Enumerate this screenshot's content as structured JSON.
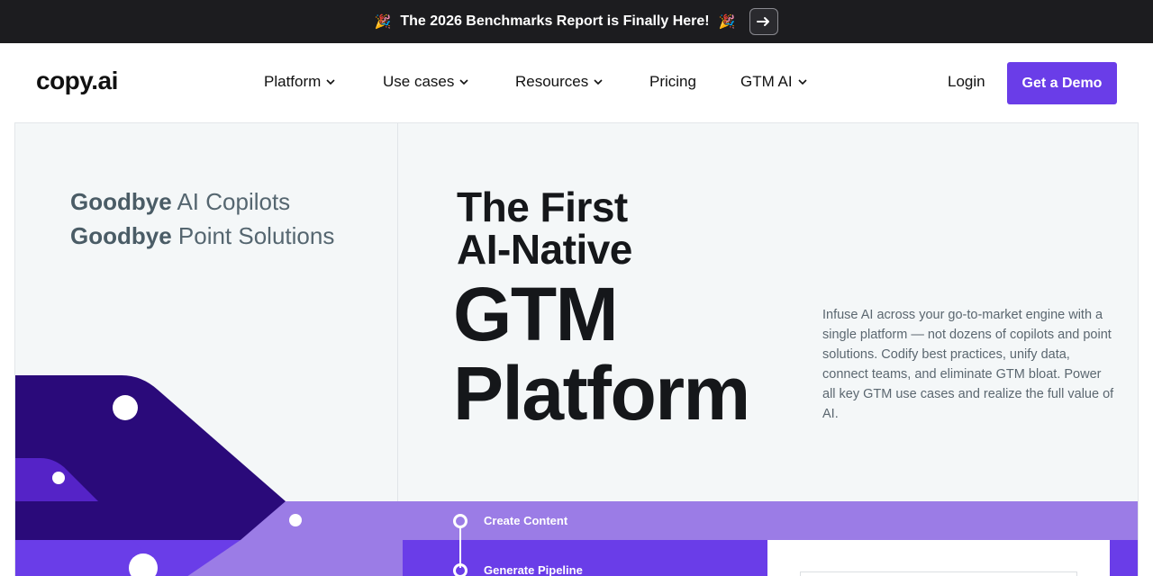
{
  "announcement": {
    "emoji_left": "🎉",
    "text": "The 2026 Benchmarks Report is Finally Here!",
    "emoji_right": "🎉",
    "button_icon": "arrow-right-icon"
  },
  "nav": {
    "logo": "copy.ai",
    "items": [
      {
        "label": "Platform",
        "has_dropdown": true
      },
      {
        "label": "Use cases",
        "has_dropdown": true
      },
      {
        "label": "Resources",
        "has_dropdown": true
      },
      {
        "label": "Pricing",
        "has_dropdown": false
      },
      {
        "label": "GTM AI",
        "has_dropdown": true
      }
    ],
    "login": "Login",
    "cta": "Get a Demo"
  },
  "hero": {
    "goodbye_1_bold": "Goodbye",
    "goodbye_1_rest": " AI Copilots",
    "goodbye_2_bold": "Goodbye",
    "goodbye_2_rest": " Point Solutions",
    "title_line_1": "The First",
    "title_line_2": "AI-Native",
    "title_line_3": "GTM",
    "title_line_4": "Platform",
    "description": "Infuse AI across your go-to-market engine with a single platform — not dozens of copilots and point solutions. Codify best practices, unify data, connect teams, and eliminate GTM bloat. Power all key GTM use cases and realize the full value of AI.",
    "steps": [
      "Create Content",
      "Generate Pipeline"
    ]
  },
  "colors": {
    "brand": "#6a3de8",
    "brand_light": "#9b7ce6",
    "brand_deep": "#2a0a7a",
    "announce_bg": "#1c1c1f"
  }
}
